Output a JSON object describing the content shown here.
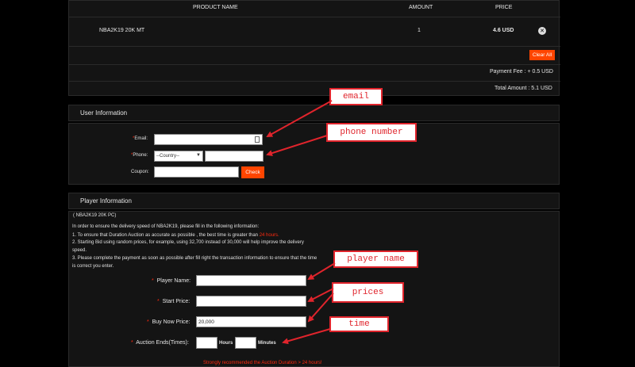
{
  "cart": {
    "col_product": "PRODUCT NAME",
    "col_amount": "AMOUNT",
    "col_price": "PRICE",
    "item_name": "NBA2K19 20K MT",
    "item_amount": "1",
    "item_price": "4.6 USD",
    "remove_icon": "close-icon",
    "clear_all": "Clear All",
    "payment_fee": "Payment Fee : + 0.5 USD",
    "total_amount": "Total Amount : 5.1 USD"
  },
  "user_info": {
    "title": "User Information",
    "email_star": "*",
    "email_label": "Email:",
    "phone_star": "*",
    "phone_label": "Phone:",
    "country_value": "--Country--",
    "coupon_label": "Coupon:",
    "check_label": "Check"
  },
  "player_info": {
    "title": "Player Information",
    "subtitle": "( NBA2K19 20K PC)",
    "intro": "In order to ensure the delivery speed of NBA2K19, please fill in the following information:",
    "point1_pre": "1. To ensure that Duration Auction as accurate as possible , the best time is greater than ",
    "point1_red": "24 hours.",
    "point2_line1": "2. Starting Bid using random prices, for example, using 32,700 instead of 30,000 will help improve the delivery",
    "point2_line2": "speed.",
    "point3_line1": "3. Please complete the payment as soon as possible after fill right the transaction information to ensure that the time",
    "point3_line2": "is correct you enter.",
    "player_name_label": "Player Name:",
    "start_price_label": "Start Price:",
    "buy_now_label": "Buy Now Price:",
    "buy_now_value": "20,000",
    "auction_label": "Auction Ends(Times):",
    "hours_label": "Hours",
    "minutes_label": "Minutes",
    "recommend": "Strongly recommended the Auction Duration > 24 hours!",
    "star": "*"
  },
  "callouts": {
    "email": "email",
    "phone": "phone number",
    "player_name": "player name",
    "prices": "prices",
    "time": "time"
  },
  "colors": {
    "accent": "#ff4500",
    "annotation": "#e0242c"
  }
}
